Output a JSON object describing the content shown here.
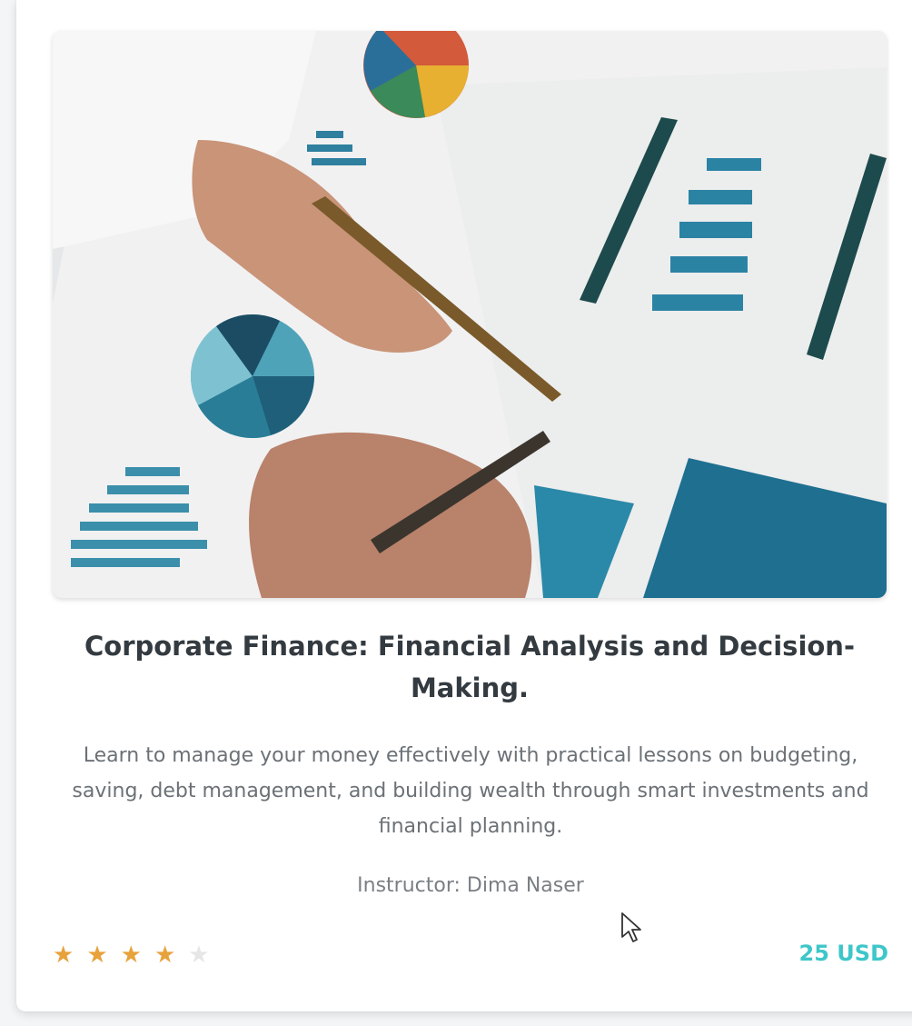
{
  "course": {
    "image_alt": "Hands holding pens over printed financial charts and reports",
    "title": "Corporate Finance: Financial Analysis and Decision-Making.",
    "description": "Learn to manage your money effectively with practical lessons on budgeting, saving, debt management, and building wealth through smart investments and financial planning.",
    "instructor": "Instructor: Dima Naser",
    "rating": 4,
    "rating_max": 5,
    "price": "25 USD"
  },
  "icons": {
    "star_filled": "star-filled-icon",
    "star_empty": "star-empty-icon",
    "cursor": "mouse-pointer-icon"
  },
  "colors": {
    "star_on": "#e8a23b",
    "star_off": "#e6e6e6",
    "price": "#3ec6c9",
    "title": "#333a40",
    "chart_teal": "#1f6f8b"
  }
}
